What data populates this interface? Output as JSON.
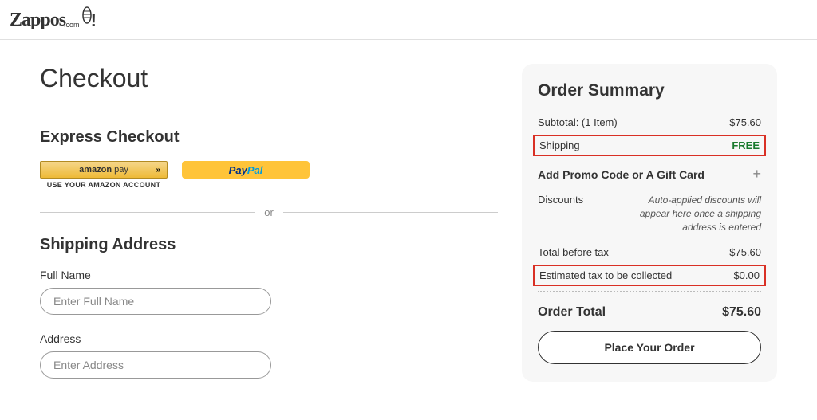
{
  "header": {
    "brand_main": "Zappos",
    "brand_sub": ".com"
  },
  "page": {
    "title": "Checkout"
  },
  "express": {
    "heading": "Express Checkout",
    "amazon_label_1": "amazon",
    "amazon_label_2": " pay",
    "amazon_arrows": "»",
    "amazon_sub": "USE YOUR AMAZON ACCOUNT",
    "paypal_1": "Pay",
    "paypal_2": "Pal",
    "divider": "or"
  },
  "shipping": {
    "heading": "Shipping Address",
    "fullname_label": "Full Name",
    "fullname_placeholder": "Enter Full Name",
    "address_label": "Address",
    "address_placeholder": "Enter Address"
  },
  "summary": {
    "title": "Order Summary",
    "subtotal_label": "Subtotal: (1 Item)",
    "subtotal_value": "$75.60",
    "shipping_label": "Shipping",
    "shipping_value": "FREE",
    "promo_label": "Add Promo Code or A Gift Card",
    "discounts_label": "Discounts",
    "discounts_text": "Auto-applied discounts will appear here once a shipping address is entered",
    "before_tax_label": "Total before tax",
    "before_tax_value": "$75.60",
    "tax_label": "Estimated tax to be collected",
    "tax_value": "$0.00",
    "total_label": "Order Total",
    "total_value": "$75.60",
    "place_order": "Place Your Order"
  }
}
